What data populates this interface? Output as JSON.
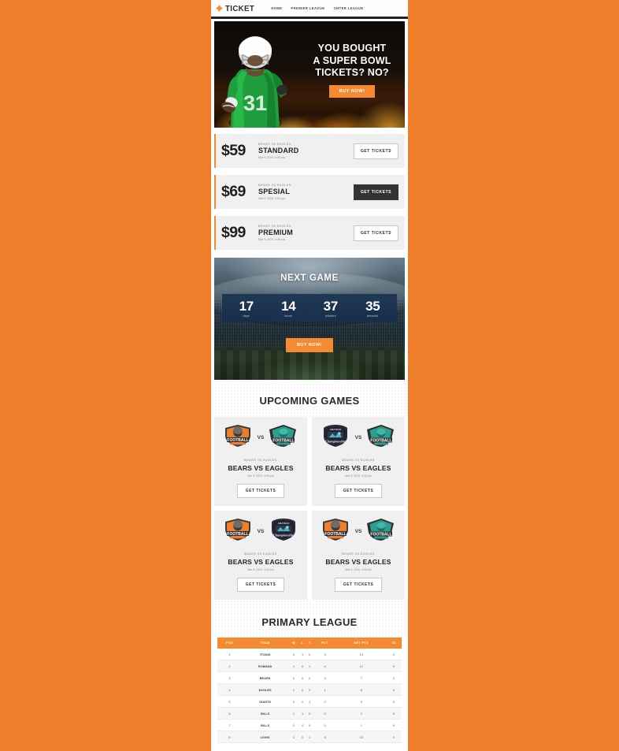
{
  "brand": {
    "name": "TICKET",
    "logo_icon": "ticket-diamond-icon",
    "accent": "#f58a33"
  },
  "nav": {
    "items": [
      {
        "label": "HOME"
      },
      {
        "label": "PREMIER LEAGUE"
      },
      {
        "label": "OHTER LEAGUE"
      }
    ]
  },
  "hero": {
    "headline_line1": "YOU BOUGHT",
    "headline_line2": "A SUPER BOWL",
    "headline_line3": "TICKETS? NO?",
    "cta": "BUY NOW!",
    "image_alt": "football-player-green-jersey-31-flames"
  },
  "pricing": {
    "cards": [
      {
        "price": "$59",
        "subtitle": "BEARS VS EAGLES",
        "name": "STANDARD",
        "date": "Mar 5, 2020, 4:00 pm",
        "cta": "GET TICKETS",
        "style": "ghost"
      },
      {
        "price": "$69",
        "subtitle": "BEARS VS EAGLES",
        "name": "SPESIAL",
        "date": "Mar 5, 2020, 4:00 pm",
        "cta": "GET TICKETS",
        "style": "dark"
      },
      {
        "price": "$99",
        "subtitle": "BEARS VS EAGLES",
        "name": "PREMIUM",
        "date": "Mar 5, 2020, 4:00 pm",
        "cta": "GET TICKETS",
        "style": "ghost"
      }
    ]
  },
  "next_game": {
    "title": "NEXT GAME",
    "countdown": [
      {
        "value": "17",
        "label": "days"
      },
      {
        "value": "14",
        "label": "hours"
      },
      {
        "value": "37",
        "label": "minutes"
      },
      {
        "value": "35",
        "label": "seconds"
      }
    ],
    "cta": "BUY NOW!"
  },
  "upcoming": {
    "title": "UPCOMING GAMES",
    "games": [
      {
        "home_logo": "football-orange-shield-logo",
        "away_logo": "football-teal-shield-logo",
        "vs": "VS",
        "subtitle": "BEARS VS EAGLES",
        "title": "BEARS VS EAGLES",
        "date": "Mar 5, 2020, 4:00 pm",
        "cta": "GET TICKETS"
      },
      {
        "home_logo": "amateur-championship-navy-logo",
        "away_logo": "football-teal-shield-logo",
        "vs": "VS",
        "subtitle": "BEARS VS EAGLES",
        "title": "BEARS VS EAGLES",
        "date": "Mar 5, 2020, 4:00 pm",
        "cta": "GET TICKETS"
      },
      {
        "home_logo": "football-orange-shield-logo",
        "away_logo": "amateur-championship-navy-logo",
        "vs": "VS",
        "subtitle": "BEARS VS EAGLES",
        "title": "BEARS VS EAGLES",
        "date": "Mar 5, 2020, 4:00 pm",
        "cta": "GET TICKETS"
      },
      {
        "home_logo": "football-orange-shield-logo",
        "away_logo": "football-teal-shield-logo",
        "vs": "VS",
        "subtitle": "BEARS VS EAGLES",
        "title": "BEARS VS EAGLES",
        "date": "Mar 5, 2020, 4:00 pm",
        "cta": "GET TICKETS"
      }
    ]
  },
  "league": {
    "title": "PRIMARY LEAGUE",
    "columns": [
      "POS",
      "TEAM",
      "W",
      "L",
      "T",
      "PCT",
      "NET PTS",
      "TD"
    ],
    "rows": [
      {
        "pos": "1",
        "team": "TITANS",
        "w": "0",
        "l": "1",
        "t": "0",
        "pct": "3",
        "net_pts": "13",
        "td": "0"
      },
      {
        "pos": "2",
        "team": "ROMANS",
        "w": "1",
        "l": "0",
        "t": "2",
        "pct": "4",
        "net_pts": "12",
        "td": "0"
      },
      {
        "pos": "3",
        "team": "BEARS",
        "w": "0",
        "l": "0",
        "t": "0",
        "pct": "3",
        "net_pts": "7",
        "td": "0"
      },
      {
        "pos": "4",
        "team": "EAGLES",
        "w": "2",
        "l": "0",
        "t": "0",
        "pct": "1",
        "net_pts": "8",
        "td": "0"
      },
      {
        "pos": "5",
        "team": "GIANTS",
        "w": "0",
        "l": "2",
        "t": "1",
        "pct": "0",
        "net_pts": "9",
        "td": "0"
      },
      {
        "pos": "6",
        "team": "BILLS",
        "w": "1",
        "l": "1",
        "t": "0",
        "pct": "0",
        "net_pts": "2",
        "td": "0"
      },
      {
        "pos": "7",
        "team": "BILLS",
        "w": "2",
        "l": "0",
        "t": "0",
        "pct": "0",
        "net_pts": "1",
        "td": "0"
      },
      {
        "pos": "8",
        "team": "LIONS",
        "w": "1",
        "l": "0",
        "t": "1",
        "pct": "4",
        "net_pts": "10",
        "td": "0"
      }
    ]
  }
}
